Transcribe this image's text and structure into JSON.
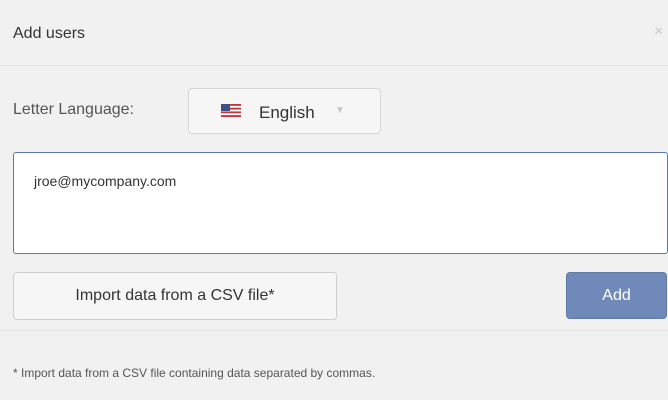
{
  "dialog": {
    "title": "Add users",
    "close_glyph": "×"
  },
  "language": {
    "label": "Letter Language:",
    "selected": "English",
    "flag_icon": "us-flag-icon",
    "caret_glyph": "▼"
  },
  "emails": {
    "value": "jroe@mycompany.com"
  },
  "actions": {
    "import_label": "Import data from a CSV file*",
    "add_label": "Add"
  },
  "footnote": "* Import data from a CSV file containing data separated by commas.",
  "colors": {
    "accent": "#6f8ab8",
    "textarea_border": "#5b7aa8",
    "background": "#f1f1f1"
  }
}
